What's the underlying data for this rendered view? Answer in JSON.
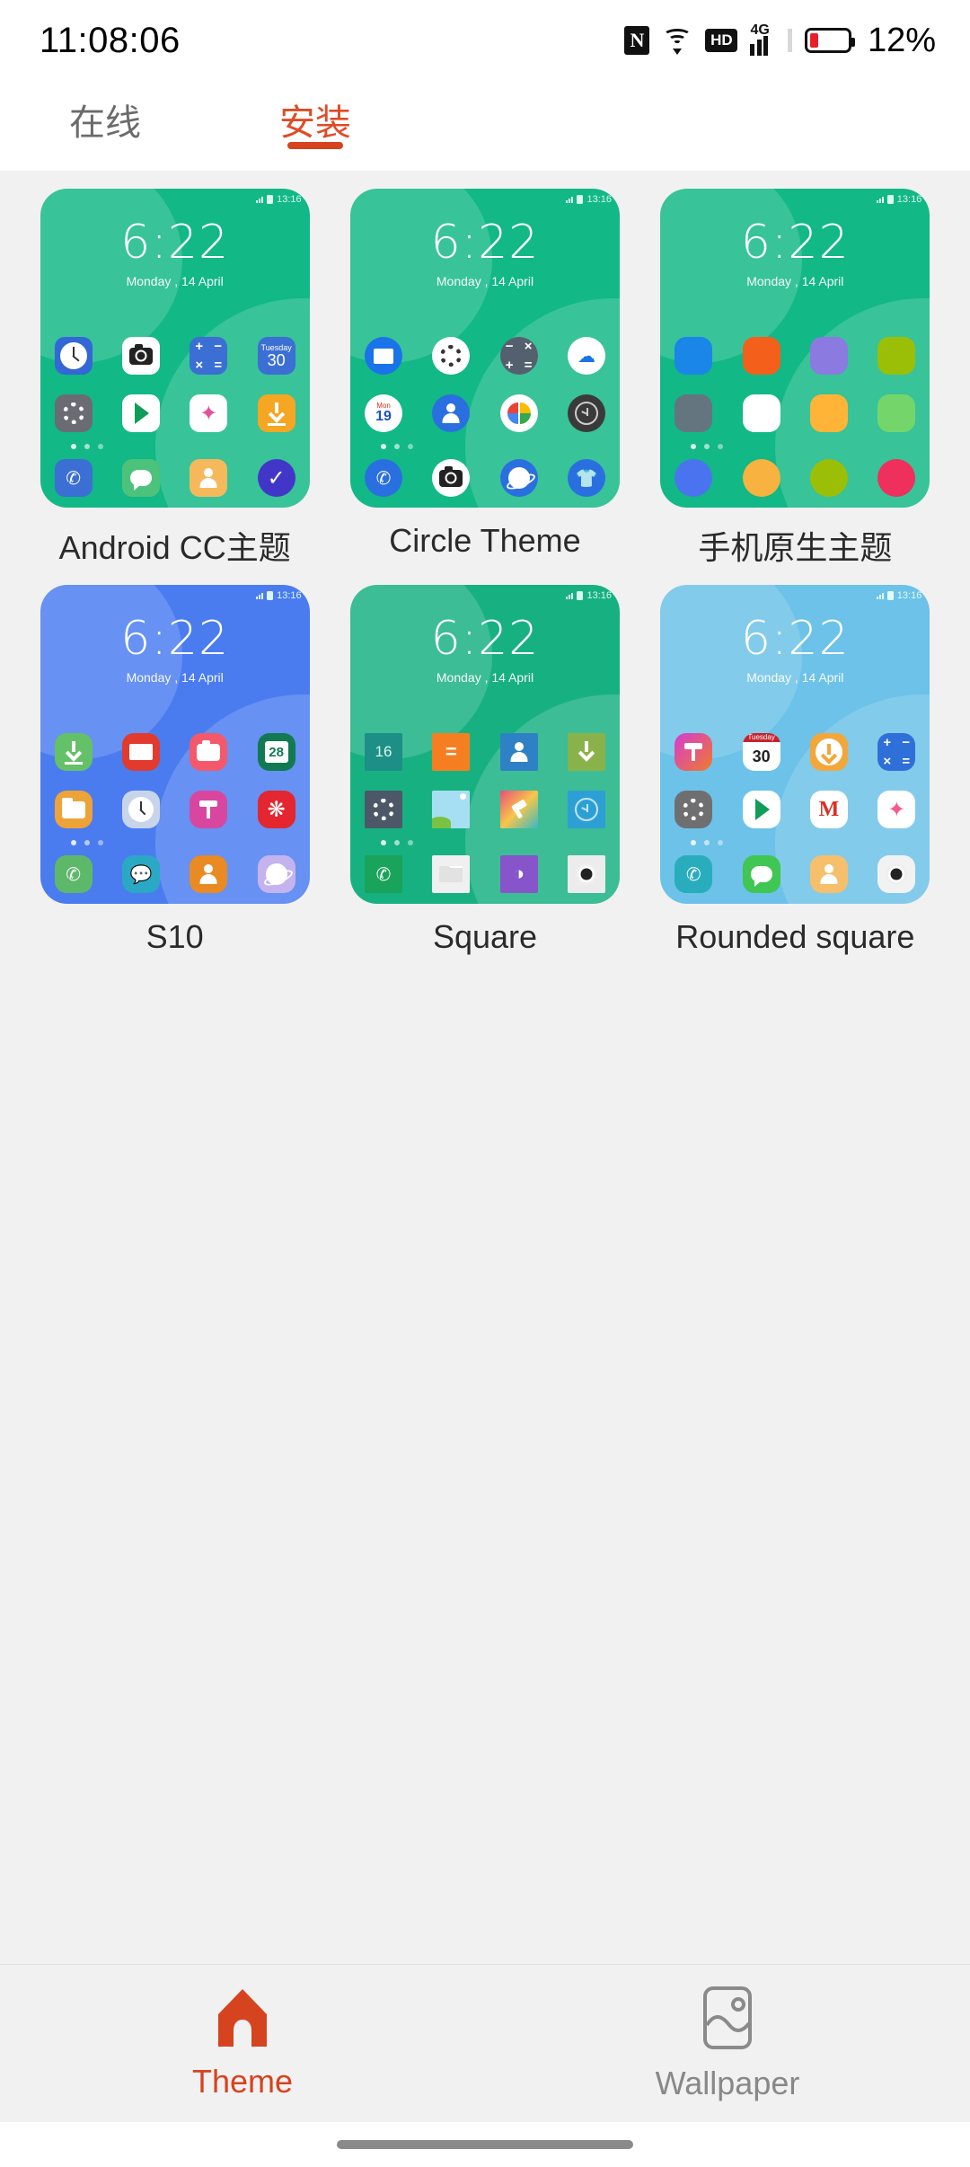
{
  "status_bar": {
    "time": "11:08:06",
    "battery_percent": "12%",
    "icons": [
      "nfc-icon",
      "wifi-icon",
      "hd-icon",
      "signal-4g-icon",
      "battery-icon"
    ],
    "network_label": "4G"
  },
  "tabs": [
    {
      "label": "在线",
      "active": false
    },
    {
      "label": "安装",
      "active": true
    }
  ],
  "accent_color": "#d6431f",
  "themes": [
    {
      "label": "Android CC主题",
      "bg": "#12b886",
      "mini_time": "13:16",
      "lock_time": "6:22",
      "lock_date": "Monday , 14 April",
      "calendar_top": "Tuesday",
      "calendar_day": "30",
      "icon_shape": "squircle"
    },
    {
      "label": "Circle Theme",
      "bg": "#12b886",
      "mini_time": "13:16",
      "lock_time": "6:22",
      "lock_date": "Monday , 14 April",
      "calendar_top": "Mon",
      "calendar_day": "19",
      "icon_shape": "circle"
    },
    {
      "label": "手机原生主题",
      "bg": "#12b886",
      "mini_time": "13:16",
      "lock_time": "6:22",
      "lock_date": "Monday , 14 April",
      "icon_shape": "plain"
    },
    {
      "label": "S10",
      "bg": "#4a7cf0",
      "mini_time": "13:16",
      "lock_time": "6:22",
      "lock_date": "Monday , 14 April",
      "calendar_day": "28",
      "icon_shape": "squircle"
    },
    {
      "label": "Square",
      "bg": "#17b181",
      "mini_time": "13:16",
      "lock_time": "6:22",
      "lock_date": "Monday , 14 April",
      "calendar_day": "16",
      "icon_shape": "square"
    },
    {
      "label": "Rounded square",
      "bg": "#6cc2e8",
      "mini_time": "13:16",
      "lock_time": "6:22",
      "lock_date": "Monday , 14 April",
      "calendar_top": "Tuesday",
      "calendar_day": "30",
      "icon_shape": "rounded-square"
    }
  ],
  "bottom_nav": [
    {
      "label": "Theme",
      "icon": "house-icon",
      "active": true
    },
    {
      "label": "Wallpaper",
      "icon": "image-icon",
      "active": false
    }
  ]
}
